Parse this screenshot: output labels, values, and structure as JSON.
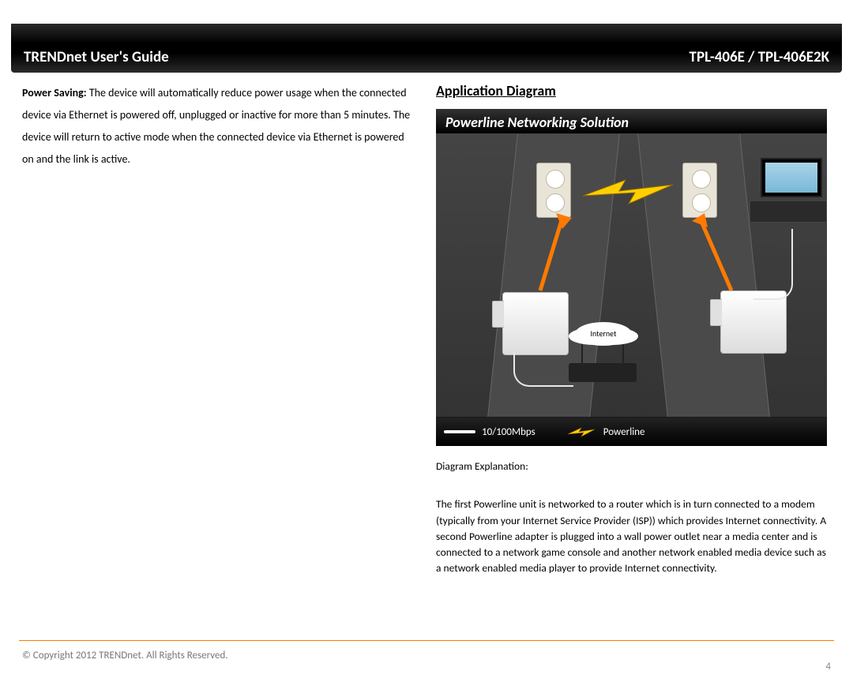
{
  "header": {
    "left": "TRENDnet User's Guide",
    "right": "TPL-406E / TPL-406E2K"
  },
  "left_col": {
    "ps_label": "Power Saving:",
    "ps_text": " The device will automatically reduce power usage when the connected device via Ethernet is powered off, unplugged or inactive for more than 5 minutes. The device will return to active mode when the connected device via Ethernet is powered on and the link is active."
  },
  "right_col": {
    "heading": "Application Diagram",
    "diagram_title": "Powerline Networking Solution",
    "legend": {
      "ethernet": "10/100Mbps",
      "powerline": "Powerline"
    },
    "internet_label": "Internet",
    "explain_label": "Diagram Explanation:",
    "explain_body": "The first Powerline unit is networked to a router which is in turn connected to a modem (typically from your Internet Service Provider (ISP)) which provides Internet connectivity. A second Powerline adapter is plugged into a wall power outlet near a media center and is connected to a network game console and another network enabled media device such as a network enabled media player to provide Internet connectivity."
  },
  "footer": {
    "copyright": "© Copyright 2012 TRENDnet. All Rights Reserved.",
    "page": "4"
  }
}
